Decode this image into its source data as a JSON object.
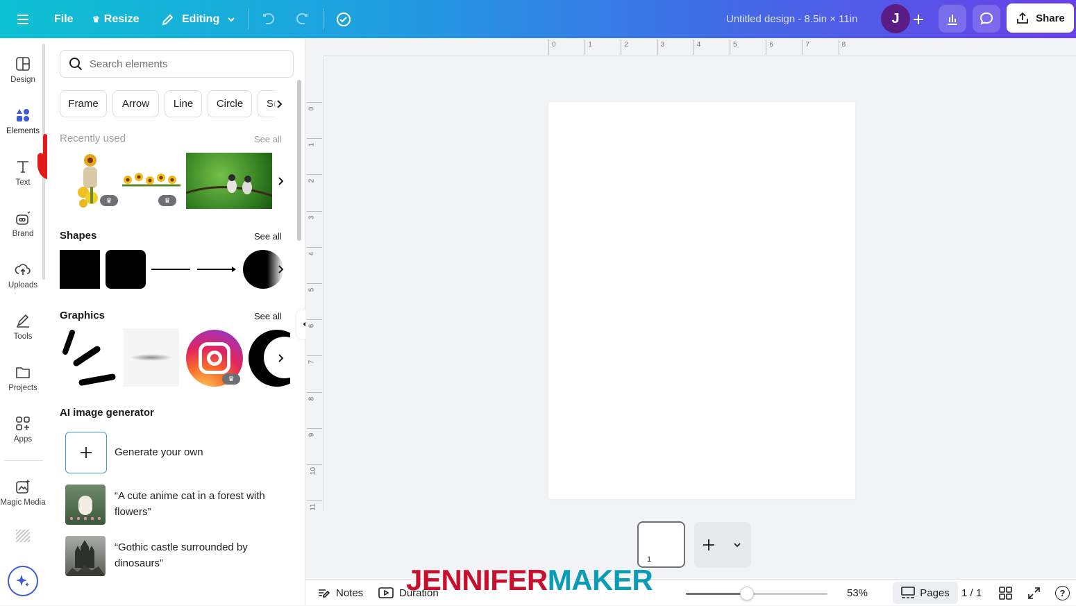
{
  "topbar": {
    "file_label": "File",
    "resize_label": "Resize",
    "editing_label": "Editing",
    "doc_title": "Untitled design - 8.5in × 11in",
    "avatar_initial": "J",
    "share_label": "Share"
  },
  "rail": {
    "items": [
      {
        "label": "Design",
        "icon": "design-icon"
      },
      {
        "label": "Elements",
        "icon": "elements-icon"
      },
      {
        "label": "Text",
        "icon": "text-icon"
      },
      {
        "label": "Brand",
        "icon": "brand-icon"
      },
      {
        "label": "Uploads",
        "icon": "uploads-icon"
      },
      {
        "label": "Tools",
        "icon": "tools-icon"
      },
      {
        "label": "Projects",
        "icon": "projects-icon"
      },
      {
        "label": "Apps",
        "icon": "apps-icon"
      },
      {
        "label": "Magic Media",
        "icon": "magic-media-icon"
      }
    ]
  },
  "panel": {
    "search_placeholder": "Search elements",
    "chips": [
      "Frame",
      "Arrow",
      "Line",
      "Circle",
      "Sc"
    ],
    "recently_used": {
      "title": "Recently used",
      "see_all": "See all"
    },
    "shapes": {
      "title": "Shapes",
      "see_all": "See all"
    },
    "graphics": {
      "title": "Graphics",
      "see_all": "See all"
    },
    "ai": {
      "title": "AI image generator",
      "generate_label": "Generate your own",
      "prompt1_line1": "“A cute anime cat in a forest with",
      "prompt1_line2": "flowers”",
      "prompt2_line1": "“Gothic castle surrounded by",
      "prompt2_line2": "dinosaurs”"
    }
  },
  "rulers": {
    "top": [
      "0",
      "1",
      "2",
      "3",
      "4",
      "5",
      "6",
      "7",
      "8"
    ],
    "left": [
      "0",
      "1",
      "2",
      "3",
      "4",
      "5",
      "6",
      "7",
      "8",
      "9",
      "10",
      "11"
    ]
  },
  "page_thumbnail": {
    "number": "1"
  },
  "footer": {
    "notes_label": "Notes",
    "duration_label": "Duration",
    "zoom_value": "53%",
    "zoom_fraction": 0.43,
    "pages_label": "Pages",
    "page_count": "1 / 1",
    "help_label": "?"
  },
  "watermark": {
    "part1": "JENNIFER",
    "part2": "MAKER",
    "color1": "#c8102e",
    "color2": "#0a9bb5"
  },
  "colors": {
    "accent": "#3d5ad8",
    "avatar": "#5b1c86",
    "cursor_hand": "#e21a1a"
  }
}
